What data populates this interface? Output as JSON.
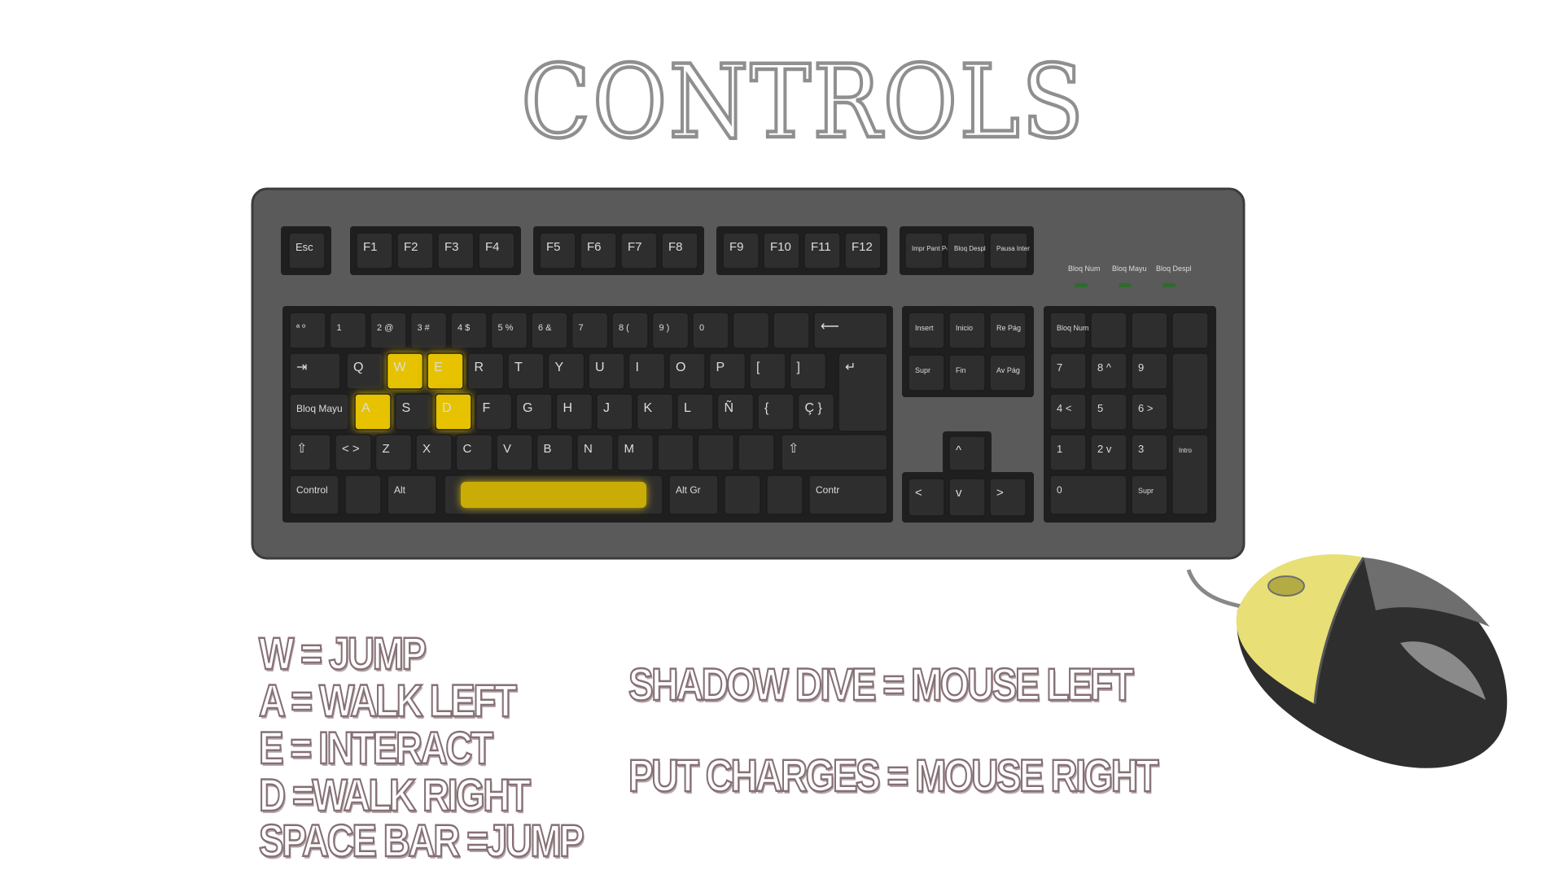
{
  "title": "CONTROLS",
  "keyboard": {
    "row_function": [
      "Esc",
      "F1",
      "F2",
      "F3",
      "F4",
      "F5",
      "F6",
      "F7",
      "F8",
      "F9",
      "F10",
      "F11",
      "F12",
      "Impr Pant Pet Sis",
      "Bloq Despl",
      "Pausa Inter"
    ],
    "indicators": [
      "Bloq Num",
      "Bloq Mayu",
      "Bloq Despl"
    ],
    "row_numbers": [
      "ª º",
      "1",
      "2 @",
      "3 #",
      "4 $",
      "5 %",
      "6 &",
      "7",
      "8 (",
      "9 )",
      "0",
      "",
      ""
    ],
    "row_qwerty": [
      "Q",
      "W",
      "E",
      "R",
      "T",
      "Y",
      "U",
      "I",
      "O",
      "P",
      "[",
      "]"
    ],
    "row_home": [
      "Bloq Mayu",
      "A",
      "S",
      "D",
      "F",
      "G",
      "H",
      "J",
      "K",
      "L",
      "Ñ",
      "{",
      "Ç }"
    ],
    "row_bottom_letters": [
      "< >",
      "Z",
      "X",
      "C",
      "V",
      "B",
      "N",
      "M",
      "",
      "",
      ""
    ],
    "row_space": [
      "Control",
      "",
      "Alt",
      "",
      "Alt Gr",
      "",
      "",
      "Contr"
    ],
    "nav_cluster": [
      "Insert",
      "Inicio",
      "Re Pág",
      "Supr",
      "Fin",
      "Av Pág"
    ],
    "numpad": [
      "Bloq Num",
      "",
      "",
      "",
      "7",
      "8 ^",
      "9",
      "4 <",
      "5",
      "6 >",
      "1",
      "2 v",
      "3",
      "0",
      "Supr",
      "Intro"
    ],
    "highlight_color": "#e6c200",
    "body_color": "#5a5a5a",
    "key_color": "#2e2e2e"
  },
  "bindings_keyboard": [
    "W = JUMP",
    "A = WALK LEFT",
    "E = INTERACT",
    "D =WALK RIGHT",
    "SPACE BAR =JUMP"
  ],
  "bindings_mouse": [
    "SHADOW DIVE = MOUSE LEFT",
    "PUT CHARGES = MOUSE RIGHT"
  ]
}
